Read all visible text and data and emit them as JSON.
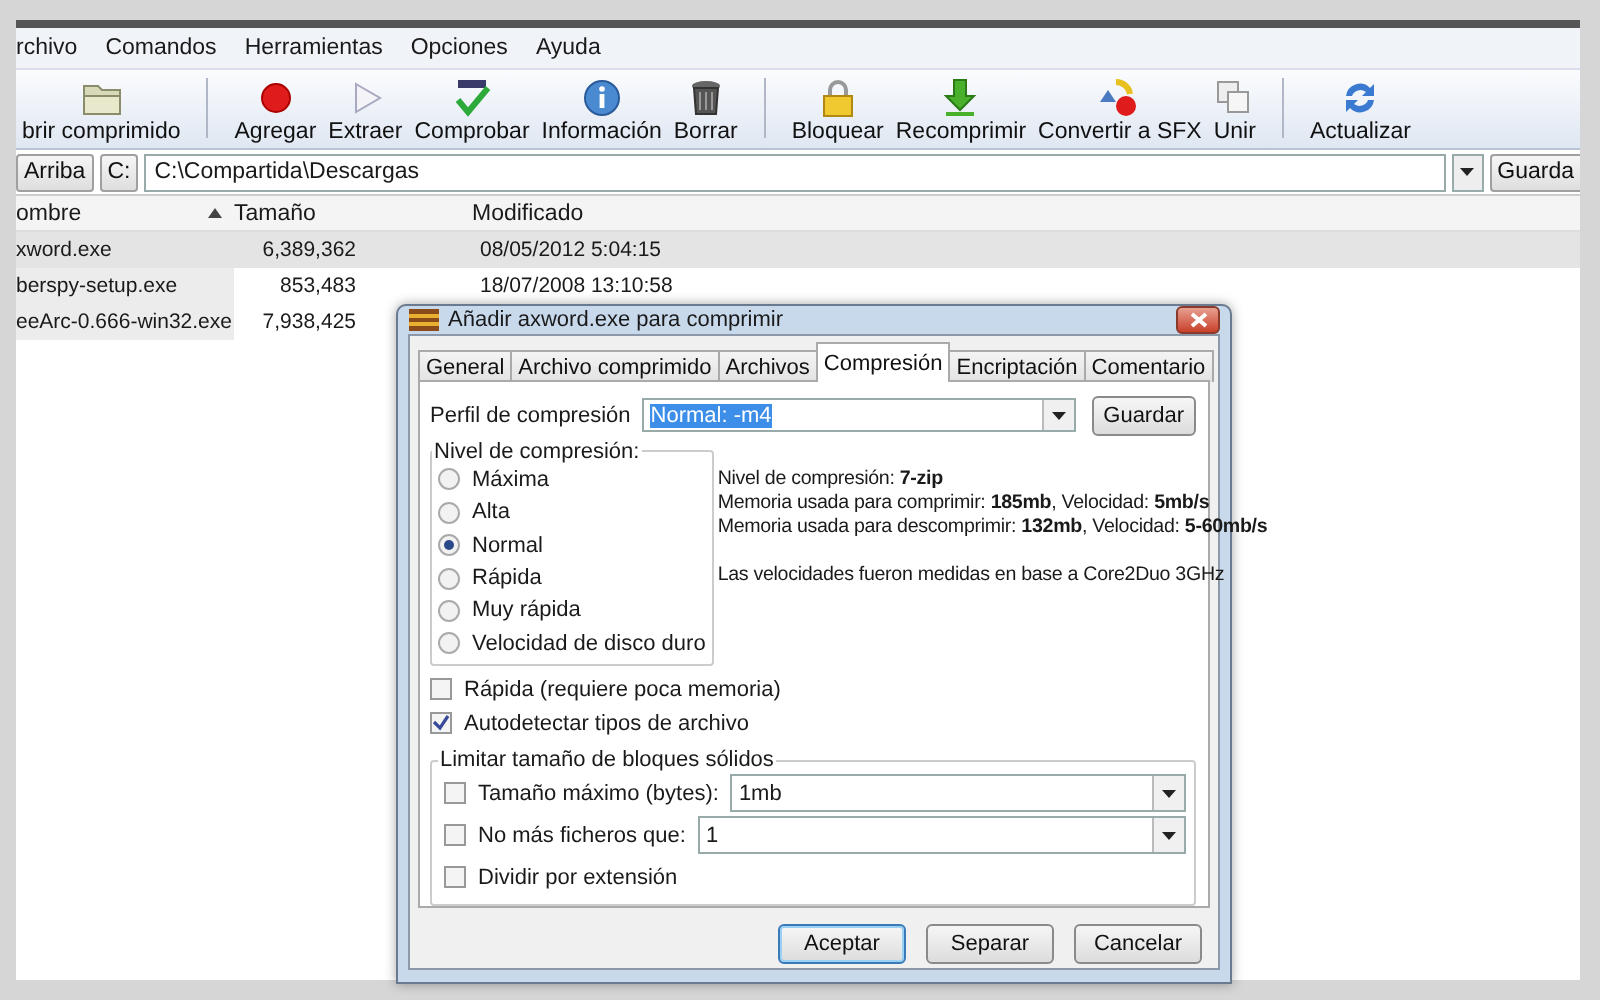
{
  "menu": [
    {
      "label": "rchivo"
    },
    {
      "label": "Comandos"
    },
    {
      "label": "Herramientas"
    },
    {
      "label": "Opciones"
    },
    {
      "label": "Ayuda"
    }
  ],
  "toolbar": [
    {
      "kind": "button",
      "label": "brir comprimido"
    },
    {
      "kind": "separator"
    },
    {
      "kind": "button",
      "label": "Agregar"
    },
    {
      "kind": "button",
      "label": "Extraer"
    },
    {
      "kind": "button",
      "label": "Comprobar"
    },
    {
      "kind": "button",
      "label": "Información"
    },
    {
      "kind": "button",
      "label": "Borrar"
    },
    {
      "kind": "separator"
    },
    {
      "kind": "button",
      "label": "Bloquear"
    },
    {
      "kind": "button",
      "label": "Recomprimir"
    },
    {
      "kind": "button",
      "label": "Convertir a SFX"
    },
    {
      "kind": "button",
      "label": "Unir"
    },
    {
      "kind": "separator"
    },
    {
      "kind": "button",
      "label": "Actualizar"
    }
  ],
  "path_bar": {
    "up_button": "Arriba",
    "drive": "C:",
    "path": "C:\\Compartida\\Descargas",
    "save_button": "Guarda"
  },
  "file_list": {
    "columns": [
      {
        "label": "ombre",
        "sorted": true
      },
      {
        "label": "Tamaño",
        "sorted": false
      },
      {
        "label": "Modificado",
        "sorted": false
      }
    ],
    "rows": [
      {
        "name": "xword.exe",
        "size": "6,389,362",
        "modified": "08/05/2012 5:04:15",
        "selected": true
      },
      {
        "name": "berspy-setup.exe",
        "size": "853,483",
        "modified": "18/07/2008 13:10:58",
        "selected": false
      },
      {
        "name": "eeArc-0.666-win32.exe",
        "size": "7,938,425",
        "selected": false
      }
    ]
  },
  "dialog": {
    "title": "Añadir axword.exe para comprimir",
    "tabs": [
      {
        "label": "General",
        "selected": false
      },
      {
        "label": "Archivo comprimido",
        "selected": false
      },
      {
        "label": "Archivos",
        "selected": false
      },
      {
        "label": "Compresión",
        "selected": true
      },
      {
        "label": "Encriptación",
        "selected": false
      },
      {
        "label": "Comentario",
        "selected": false
      }
    ],
    "profile": {
      "label": "Perfil de compresión",
      "value": "Normal: -m4",
      "save_button": "Guardar"
    },
    "level_group": {
      "title": "Nivel de compresión:",
      "options": [
        {
          "label": "Máxima",
          "selected": false
        },
        {
          "label": "Alta",
          "selected": false
        },
        {
          "label": "Normal",
          "selected": true
        },
        {
          "label": "Rápida",
          "selected": false
        },
        {
          "label": "Muy rápida",
          "selected": false
        },
        {
          "label": "Velocidad de disco duro",
          "selected": false
        }
      ]
    },
    "info": [
      "Nivel de compresión: **7-zip**",
      "Memoria usada para comprimir: **185mb**, Velocidad: **5mb/s**",
      "Memoria usada para descomprimir: **132mb**, Velocidad: **5-60mb/s**",
      "Las velocidades fueron medidas en base a Core2Duo 3GHz"
    ],
    "checkboxes": [
      {
        "label": "Rápida (requiere poca memoria)",
        "checked": false
      },
      {
        "label": "Autodetectar tipos de archivo",
        "checked": true
      }
    ],
    "solid_group": {
      "title": "Limitar tamaño de bloques sólidos",
      "rows": [
        {
          "kind": "combo",
          "label": "Tamaño máximo (bytes):",
          "checked": false,
          "value": "1mb"
        },
        {
          "kind": "combo",
          "label": "No más ficheros que:",
          "checked": false,
          "value": "1"
        },
        {
          "kind": "check",
          "label": "Dividir por extensión",
          "checked": false
        }
      ]
    },
    "buttons": [
      {
        "label": "Aceptar",
        "default": true
      },
      {
        "label": "Separar",
        "default": false
      },
      {
        "label": "Cancelar",
        "default": false
      }
    ]
  }
}
